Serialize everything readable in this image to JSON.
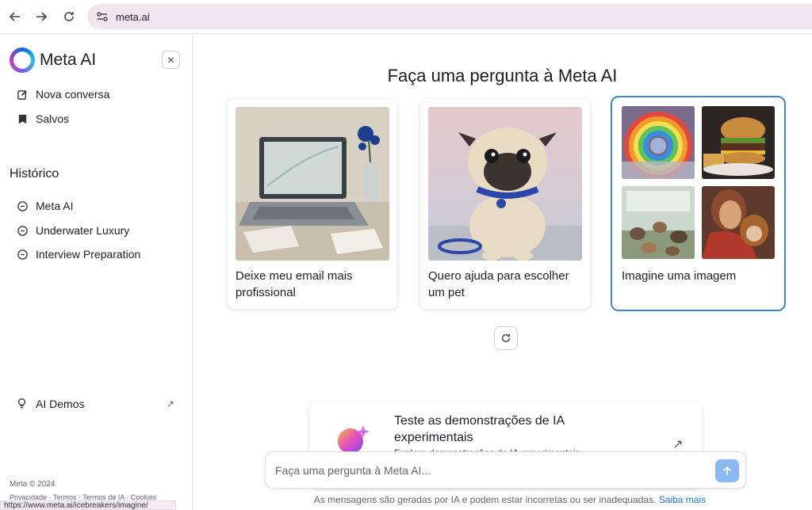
{
  "browser": {
    "url": "meta.ai"
  },
  "sidebar": {
    "brand": "Meta AI",
    "nav": [
      {
        "label": "Nova conversa",
        "icon": "edit-icon"
      },
      {
        "label": "Salvos",
        "icon": "bookmark-icon"
      }
    ],
    "history_title": "Histórico",
    "history": [
      {
        "label": "Meta AI"
      },
      {
        "label": "Underwater Luxury"
      },
      {
        "label": "Interview Preparation"
      }
    ],
    "ai_demos": "AI Demos",
    "copyright": "Meta © 2024",
    "footer_links": "Privacidade · Termos · Termos de IA · Cookies"
  },
  "status_url": "https://www.meta.ai/icebreakers/imagine/",
  "main": {
    "headline": "Faça uma pergunta à Meta AI",
    "cards": [
      {
        "caption": "Deixe meu email mais profissional"
      },
      {
        "caption": "Quero ajuda para escolher um pet"
      },
      {
        "caption": "Imagine uma imagem"
      }
    ],
    "demo": {
      "title": "Teste as demonstrações de IA experimentais",
      "subtitle": "Explore demonstrações de IA experimentais"
    },
    "composer": {
      "placeholder": "Faça uma pergunta à Meta AI..."
    },
    "disclaimer": "As mensagens são geradas por IA e podem estar incorretas ou ser inadequadas.",
    "disclaimer_link": "Saiba mais"
  },
  "colors": {
    "accent": "#1b74e4",
    "selected_border": "#3a86d4",
    "address_bar": "#f3e5f0"
  }
}
